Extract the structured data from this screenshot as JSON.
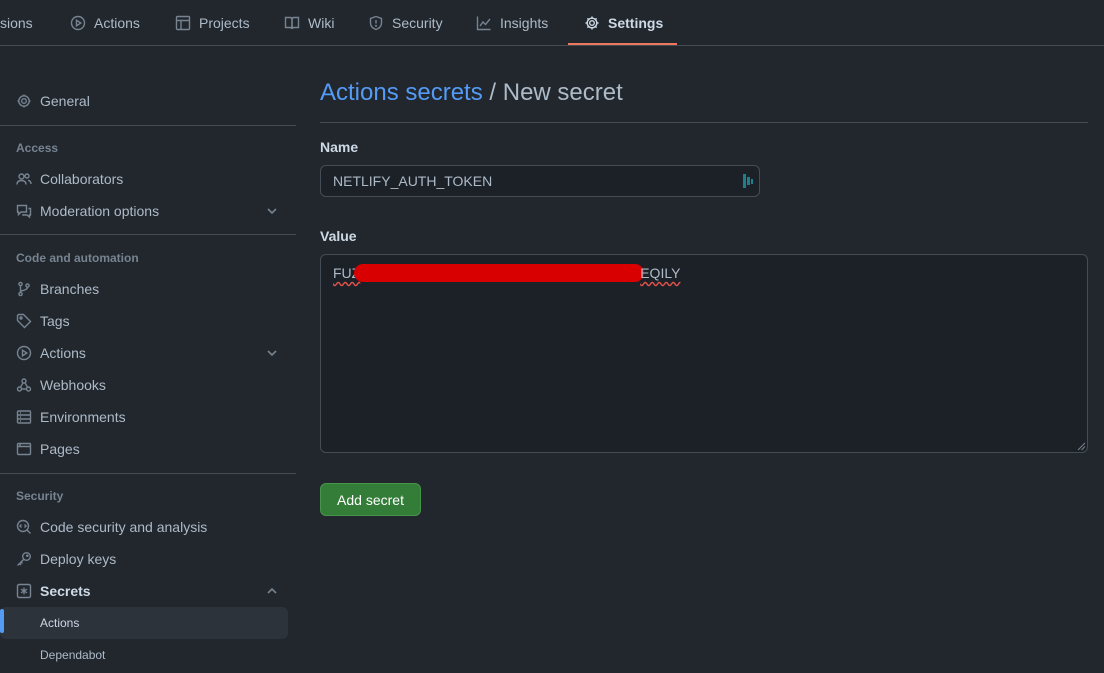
{
  "topnav": {
    "tabs": [
      {
        "label": "sions",
        "icon": "none"
      },
      {
        "label": "Actions",
        "icon": "play-icon"
      },
      {
        "label": "Projects",
        "icon": "table-icon"
      },
      {
        "label": "Wiki",
        "icon": "book-icon"
      },
      {
        "label": "Security",
        "icon": "shield-icon"
      },
      {
        "label": "Insights",
        "icon": "graph-icon"
      },
      {
        "label": "Settings",
        "icon": "gear-icon",
        "selected": true
      }
    ],
    "accent_color": "#ec775c"
  },
  "sidebar": {
    "general": "General",
    "access_heading": "Access",
    "collaborators": "Collaborators",
    "moderation": "Moderation options",
    "code_heading": "Code and automation",
    "branches": "Branches",
    "tags": "Tags",
    "actions": "Actions",
    "webhooks": "Webhooks",
    "environments": "Environments",
    "pages": "Pages",
    "security_heading": "Security",
    "code_security": "Code security and analysis",
    "deploy_keys": "Deploy keys",
    "secrets": "Secrets",
    "secrets_actions": "Actions",
    "secrets_dependabot": "Dependabot"
  },
  "main": {
    "breadcrumb_link": "Actions secrets",
    "breadcrumb_rest": " / New secret",
    "name_label": "Name",
    "name_value": "NETLIFY_AUTH_TOKEN",
    "value_label": "Value",
    "value_start": "FUZ",
    "value_end": "EQILY",
    "submit_label": "Add secret"
  },
  "colors": {
    "background": "#22272e",
    "link": "#539bf5",
    "button": "#347d39",
    "redaction": "#d80000"
  }
}
